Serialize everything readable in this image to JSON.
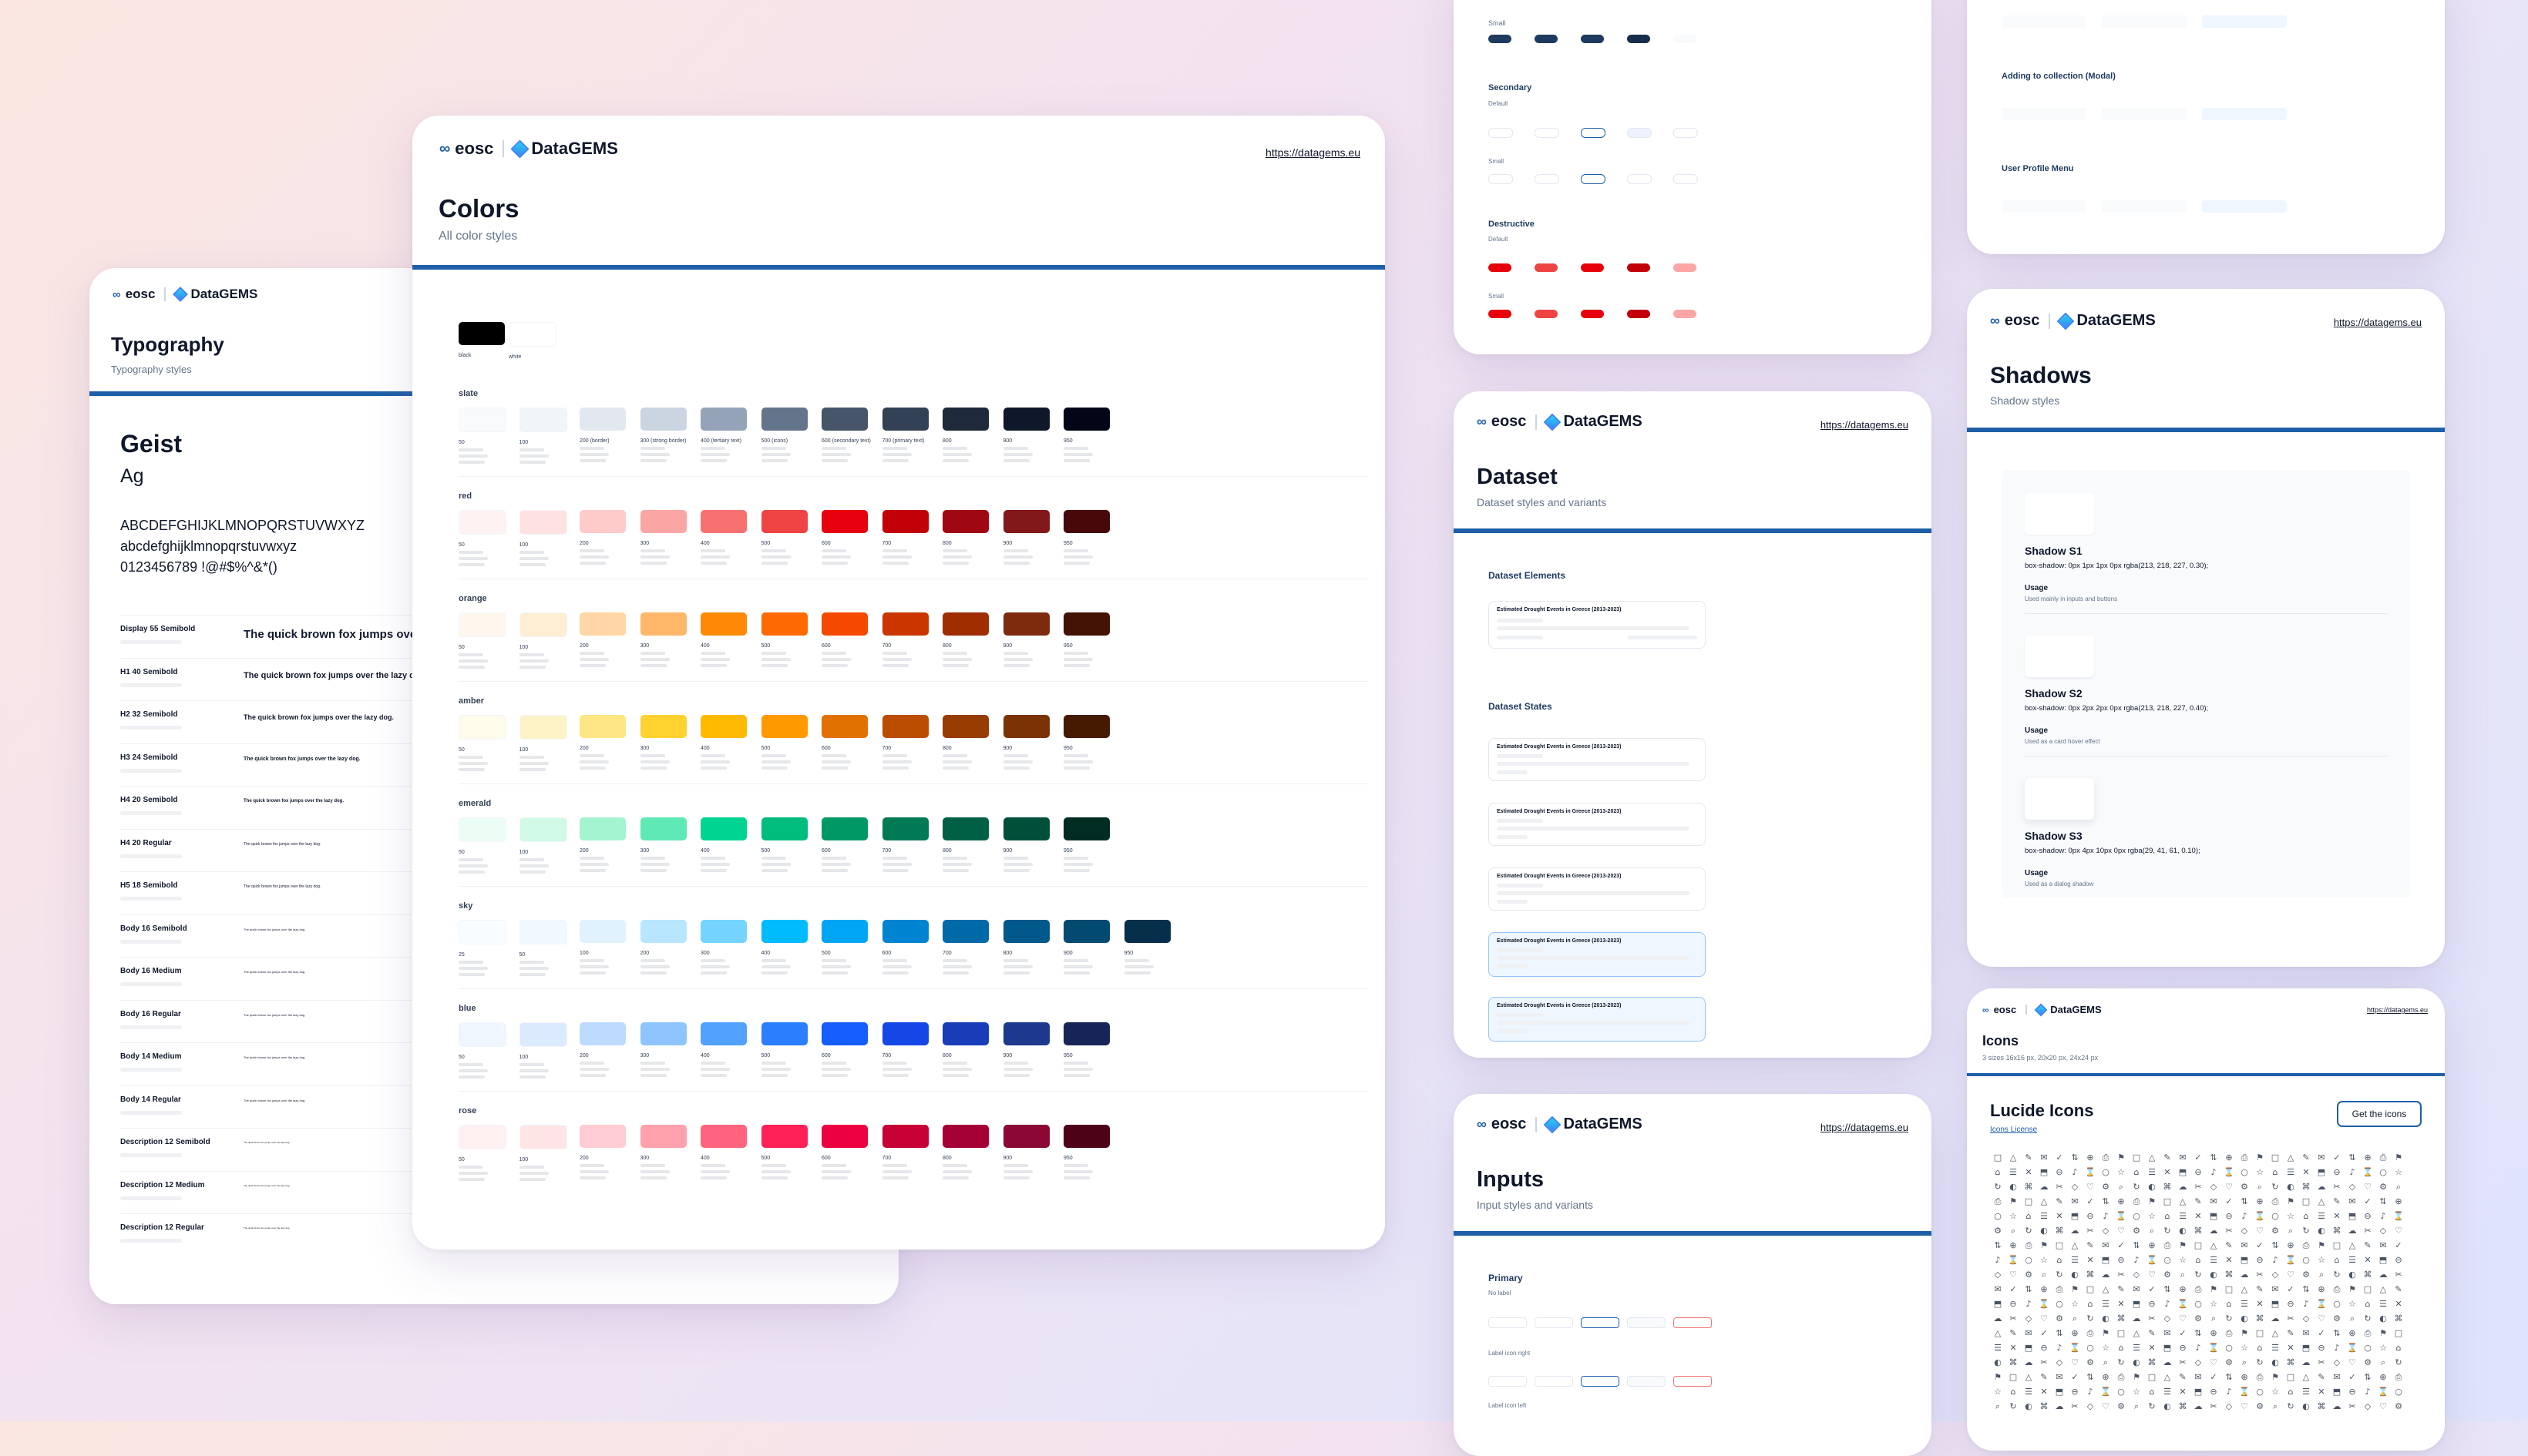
{
  "brand": {
    "eosc": "eosc",
    "datagems": "DataGEMS",
    "url": "https://datagems.eu"
  },
  "colors": {
    "accent": "#1e5fa8",
    "text": "#0f172a"
  },
  "typography": {
    "title": "Typography",
    "subtitle": "Typography styles",
    "font_name": "Geist",
    "sample_ag": "Ag",
    "upper": "ABCDEFGHIJKLMNOPQRSTUVWXYZ",
    "lower": "abcdefghijklmnopqrstuvwxyz",
    "digits": "0123456789 !@#$%^&*()",
    "rows": [
      {
        "name": "Display 55 Semibold",
        "sample": "The quick brown fox jumps over the lazy dog.",
        "size": 15
      },
      {
        "name": "H1 40 Semibold",
        "sample": "The quick brown fox jumps over the lazy dog.",
        "size": 11
      },
      {
        "name": "H2 32 Semibold",
        "sample": "The quick brown fox jumps over the lazy dog.",
        "size": 9
      },
      {
        "name": "H3 24 Semibold",
        "sample": "The quick brown fox jumps over the lazy dog.",
        "size": 7
      },
      {
        "name": "H4 20 Semibold",
        "sample": "The quick brown fox jumps over the lazy dog.",
        "size": 6
      },
      {
        "name": "H4 20 Regular",
        "sample": "The quick brown fox jumps over the lazy dog.",
        "size": 5
      },
      {
        "name": "H5 18 Semibold",
        "sample": "The quick brown fox jumps over the lazy dog.",
        "size": 5
      },
      {
        "name": "Body 16 Semibold",
        "sample": "The quick brown fox jumps over the lazy dog.",
        "size": 4
      },
      {
        "name": "Body 16 Medium",
        "sample": "The quick brown fox jumps over the lazy dog.",
        "size": 4
      },
      {
        "name": "Body 16 Regular",
        "sample": "The quick brown fox jumps over the lazy dog.",
        "size": 4
      },
      {
        "name": "Body 14 Medium",
        "sample": "The quick brown fox jumps over the lazy dog.",
        "size": 4
      },
      {
        "name": "Body 14 Regular",
        "sample": "The quick brown fox jumps over the lazy dog.",
        "size": 4
      },
      {
        "name": "Description 12 Semibold",
        "sample": "The quick brown fox jumps over the lazy dog.",
        "size": 3
      },
      {
        "name": "Description 12 Medium",
        "sample": "The quick brown fox jumps over the lazy dog.",
        "size": 3
      },
      {
        "name": "Description 12 Regular",
        "sample": "The quick brown fox jumps over the lazy dog.",
        "size": 3
      }
    ]
  },
  "palette": {
    "title": "Colors",
    "subtitle": "All color styles",
    "base": [
      {
        "label": "black",
        "hex": "#000000"
      },
      {
        "label": "white",
        "hex": "#ffffff"
      }
    ],
    "families": [
      {
        "name": "slate",
        "swatches": [
          {
            "label": "50",
            "hex": "#f8fafc"
          },
          {
            "label": "100",
            "hex": "#f1f5f9"
          },
          {
            "label": "200 (border)",
            "hex": "#e2e8f0"
          },
          {
            "label": "300 (strong border)",
            "hex": "#cbd5e1"
          },
          {
            "label": "400 (tertiary text)",
            "hex": "#94a3b8"
          },
          {
            "label": "500 (icons)",
            "hex": "#64748b"
          },
          {
            "label": "600 (secondary text)",
            "hex": "#475569"
          },
          {
            "label": "700 (primary text)",
            "hex": "#334155"
          },
          {
            "label": "800",
            "hex": "#1e293b"
          },
          {
            "label": "900",
            "hex": "#0f172a"
          },
          {
            "label": "950",
            "hex": "#020617"
          }
        ]
      },
      {
        "name": "red",
        "swatches": [
          {
            "label": "50",
            "hex": "#fef2f2"
          },
          {
            "label": "100",
            "hex": "#fee2e2"
          },
          {
            "label": "200",
            "hex": "#fecaca"
          },
          {
            "label": "300",
            "hex": "#fca5a5"
          },
          {
            "label": "400",
            "hex": "#f87171"
          },
          {
            "label": "500",
            "hex": "#ef4444"
          },
          {
            "label": "600",
            "hex": "#e7000b"
          },
          {
            "label": "700",
            "hex": "#c10007"
          },
          {
            "label": "800",
            "hex": "#9f0712"
          },
          {
            "label": "900",
            "hex": "#82181a"
          },
          {
            "label": "950",
            "hex": "#460809"
          }
        ]
      },
      {
        "name": "orange",
        "swatches": [
          {
            "label": "50",
            "hex": "#fff7ed"
          },
          {
            "label": "100",
            "hex": "#ffedd4"
          },
          {
            "label": "200",
            "hex": "#ffd6a7"
          },
          {
            "label": "300",
            "hex": "#ffb86a"
          },
          {
            "label": "400",
            "hex": "#ff8904"
          },
          {
            "label": "500",
            "hex": "#ff6900"
          },
          {
            "label": "600",
            "hex": "#f54900"
          },
          {
            "label": "700",
            "hex": "#ca3500"
          },
          {
            "label": "800",
            "hex": "#9f2d00"
          },
          {
            "label": "900",
            "hex": "#7e2a0c"
          },
          {
            "label": "950",
            "hex": "#441306"
          }
        ]
      },
      {
        "name": "amber",
        "swatches": [
          {
            "label": "50",
            "hex": "#fffbeb"
          },
          {
            "label": "100",
            "hex": "#fef3c6"
          },
          {
            "label": "200",
            "hex": "#fee685"
          },
          {
            "label": "300",
            "hex": "#ffd230"
          },
          {
            "label": "400",
            "hex": "#ffb900"
          },
          {
            "label": "500",
            "hex": "#fe9a00"
          },
          {
            "label": "600",
            "hex": "#e17100"
          },
          {
            "label": "700",
            "hex": "#bb4d00"
          },
          {
            "label": "800",
            "hex": "#973c00"
          },
          {
            "label": "900",
            "hex": "#7b3306"
          },
          {
            "label": "950",
            "hex": "#461901"
          }
        ]
      },
      {
        "name": "emerald",
        "swatches": [
          {
            "label": "50",
            "hex": "#ecfdf5"
          },
          {
            "label": "100",
            "hex": "#d0fae5"
          },
          {
            "label": "200",
            "hex": "#a4f4cf"
          },
          {
            "label": "300",
            "hex": "#5ee9b5"
          },
          {
            "label": "400",
            "hex": "#00d492"
          },
          {
            "label": "500",
            "hex": "#00bc7d"
          },
          {
            "label": "600",
            "hex": "#009966"
          },
          {
            "label": "700",
            "hex": "#007a55"
          },
          {
            "label": "800",
            "hex": "#006045"
          },
          {
            "label": "900",
            "hex": "#004f3b"
          },
          {
            "label": "950",
            "hex": "#002c22"
          }
        ]
      },
      {
        "name": "sky",
        "swatches": [
          {
            "label": "25",
            "hex": "#fafdff"
          },
          {
            "label": "50",
            "hex": "#f0f9ff"
          },
          {
            "label": "100",
            "hex": "#dff2fe"
          },
          {
            "label": "200",
            "hex": "#b8e6fe"
          },
          {
            "label": "300",
            "hex": "#74d4ff"
          },
          {
            "label": "400",
            "hex": "#00bcff"
          },
          {
            "label": "500",
            "hex": "#00a6f4"
          },
          {
            "label": "600",
            "hex": "#0084d1"
          },
          {
            "label": "700",
            "hex": "#0069a8"
          },
          {
            "label": "800",
            "hex": "#00598a"
          },
          {
            "label": "900",
            "hex": "#024a70"
          },
          {
            "label": "950",
            "hex": "#052f4a"
          }
        ]
      },
      {
        "name": "blue",
        "swatches": [
          {
            "label": "50",
            "hex": "#eff6ff"
          },
          {
            "label": "100",
            "hex": "#dbeafe"
          },
          {
            "label": "200",
            "hex": "#bedbff"
          },
          {
            "label": "300",
            "hex": "#8ec5ff"
          },
          {
            "label": "400",
            "hex": "#51a2ff"
          },
          {
            "label": "500",
            "hex": "#2b7fff"
          },
          {
            "label": "600",
            "hex": "#155dfc"
          },
          {
            "label": "700",
            "hex": "#1447e6"
          },
          {
            "label": "800",
            "hex": "#193cb8"
          },
          {
            "label": "900",
            "hex": "#1c398e"
          },
          {
            "label": "950",
            "hex": "#162456"
          }
        ]
      },
      {
        "name": "rose",
        "swatches": [
          {
            "label": "50",
            "hex": "#fff1f2"
          },
          {
            "label": "100",
            "hex": "#ffe4e6"
          },
          {
            "label": "200",
            "hex": "#ffccd3"
          },
          {
            "label": "300",
            "hex": "#ffa1ad"
          },
          {
            "label": "400",
            "hex": "#ff637e"
          },
          {
            "label": "500",
            "hex": "#ff2056"
          },
          {
            "label": "600",
            "hex": "#ec003f"
          },
          {
            "label": "700",
            "hex": "#c70036"
          },
          {
            "label": "800",
            "hex": "#a50036"
          },
          {
            "label": "900",
            "hex": "#8b0836"
          },
          {
            "label": "950",
            "hex": "#4d0218"
          }
        ]
      }
    ]
  },
  "buttons": {
    "small": "Small",
    "secondary": "Secondary",
    "default": "Default",
    "destructive": "Destructive"
  },
  "dataset": {
    "title": "Dataset",
    "subtitle": "Dataset styles and variants",
    "elements": "Dataset Elements",
    "states": "Dataset States",
    "item_title": "Estimated Drought Events in Greece (2013-2023)"
  },
  "inputs": {
    "title": "Inputs",
    "subtitle": "Input styles and variants",
    "primary": "Primary",
    "no_label": "No label",
    "label_icon_right": "Label icon right",
    "label_icon_left": "Label icon left"
  },
  "menus": {
    "adding": "Adding to collection (Modal)",
    "profile": "User Profile Menu"
  },
  "shadows": {
    "title": "Shadows",
    "subtitle": "Shadow styles",
    "usage": "Usage",
    "items": [
      {
        "name": "Shadow S1",
        "css": "box-shadow: 0px 1px 1px 0px rgba(213, 218, 227, 0.30);",
        "usage": "Used mainly in inputs and buttons"
      },
      {
        "name": "Shadow S2",
        "css": "box-shadow: 0px 2px 2px 0px rgba(213, 218, 227, 0.40);",
        "usage": "Used as a card hover effect"
      },
      {
        "name": "Shadow S3",
        "css": "box-shadow: 0px 4px 10px 0px rgba(29, 41, 61, 0.10);",
        "usage": "Used as a dialog shadow"
      }
    ]
  },
  "icons": {
    "title": "Icons",
    "subtitle": "3 sizes 16x16 px, 20x20 px, 24x24 px",
    "set_name": "Lucide Icons",
    "license": "Icons License",
    "cta": "Get the icons"
  }
}
